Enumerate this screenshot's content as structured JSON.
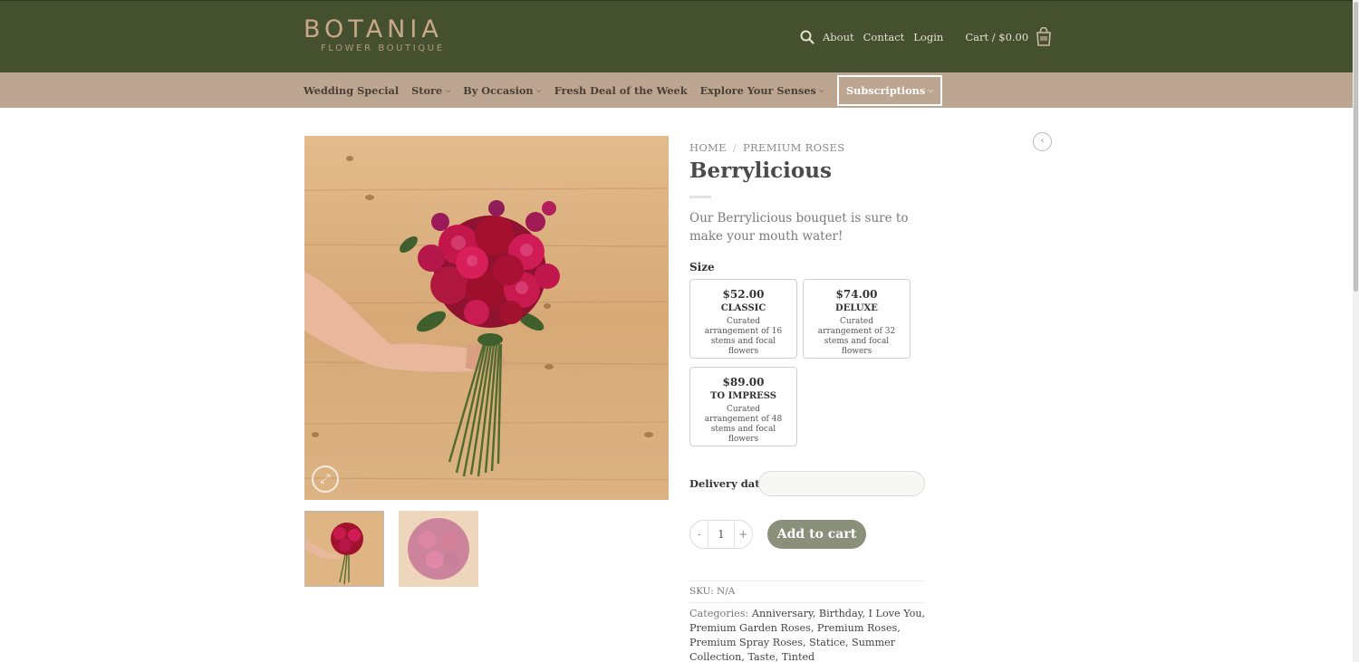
{
  "brand": {
    "name": "BOTANIA",
    "tagline": "FLOWER BOUTIQUE"
  },
  "header": {
    "links": [
      "About",
      "Contact",
      "Login"
    ],
    "cart_label": "Cart / $0.00",
    "icons": [
      "search-icon",
      "shopping-bag-icon"
    ]
  },
  "subnav": {
    "items": [
      {
        "label": "Wedding Special",
        "dropdown": false
      },
      {
        "label": "Store",
        "dropdown": true
      },
      {
        "label": "By Occasion",
        "dropdown": true
      },
      {
        "label": "Fresh Deal of the Week",
        "dropdown": false
      },
      {
        "label": "Explore Your Senses",
        "dropdown": true
      },
      {
        "label": "Subscriptions",
        "dropdown": true
      }
    ],
    "chevron": "⌵"
  },
  "product": {
    "breadcrumb": [
      "HOME",
      "PREMIUM ROSES"
    ],
    "breadcrumb_sep": "/",
    "title": "Berrylicious",
    "description": "Our Berrylicious bouquet is sure to make your mouth water!",
    "size_label": "Size",
    "sizes": [
      {
        "price": "$52.00",
        "name": "CLASSIC",
        "detail": "Curated arrangement of 16 stems and focal flowers"
      },
      {
        "price": "$74.00",
        "name": "DELUXE",
        "detail": "Curated arrangement of 32 stems and focal flowers"
      },
      {
        "price": "$89.00",
        "name": "TO IMPRESS",
        "detail": "Curated arrangement of 48 stems and focal flowers"
      }
    ],
    "delivery_label": "Delivery date",
    "delivery_value": "",
    "qty_minus": "-",
    "qty_value": "1",
    "qty_plus": "+",
    "add_to_cart": "Add to cart",
    "sku": "SKU: N/A",
    "categories_label": "Categories:",
    "categories": "Anniversary, Birthday, I Love You, Premium Garden Roses, Premium Roses, Premium Spray Roses, Statice, Summer Collection, Taste, Tinted"
  },
  "colors": {
    "header_bg": "#45502f",
    "subnav_bg": "#bca591",
    "logo": "#c9a98a",
    "button": "#8b907b"
  }
}
